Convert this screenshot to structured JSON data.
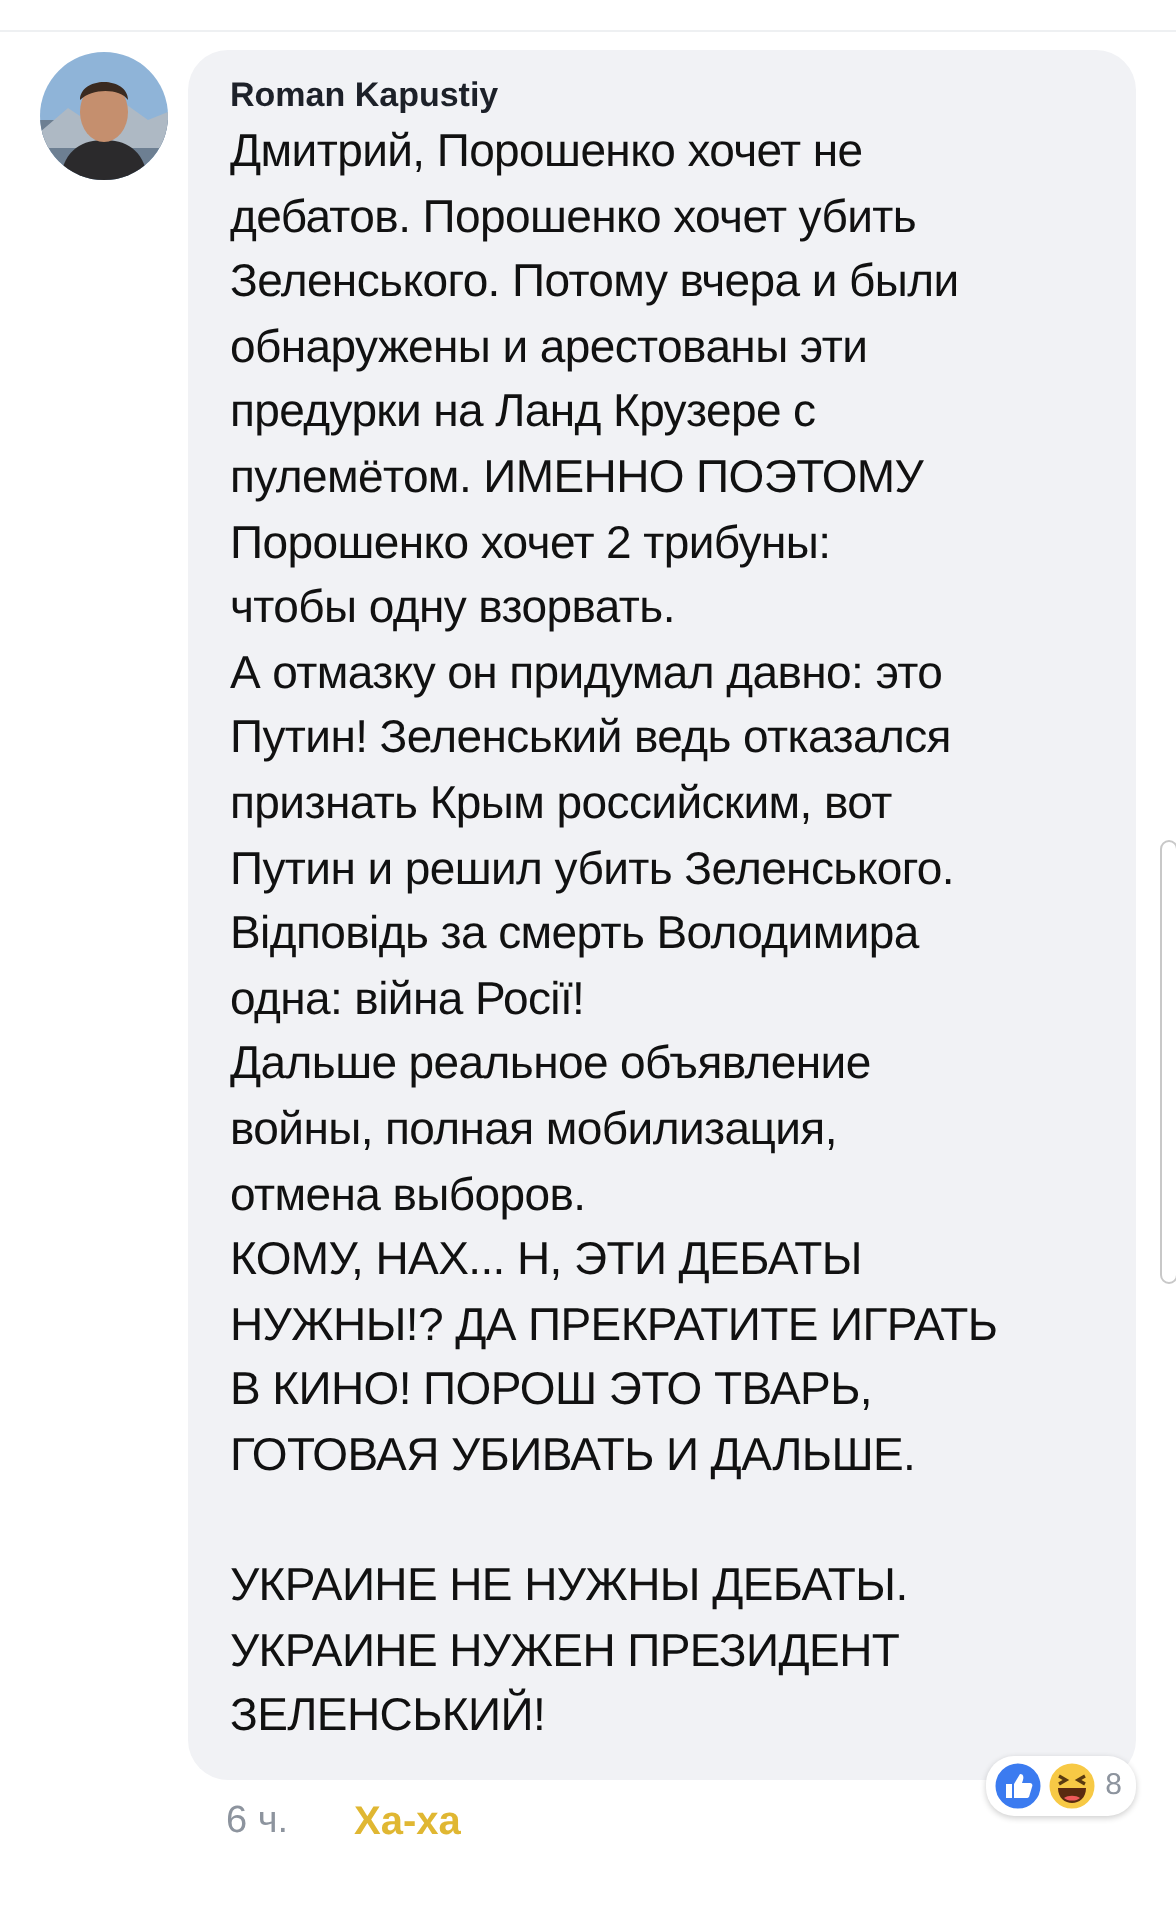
{
  "comment": {
    "author": "Roman Kapustiy",
    "paragraphs": [
      {
        "text": "Дмитрий, Порошенко хочет не\nдебатов. Порошенко хочет убить\nЗеленського. Потому вчера и были\nобнаружены и арестованы эти\nпредурки на Ланд Крузере с\nпулемётом. ИМЕННО ПОЭТОМУ\nПорошенко хочет 2 трибуны:\nчтобы одну взорвать.",
        "gap_before": false
      },
      {
        "text": "А отмазку он придумал давно: это\nПутин! Зеленський ведь отказался\nпризнать Крым российским, вот\nПутин и решил убить Зеленського.\nВідповідь за смерть Володимира\nодна: війна Росії!",
        "gap_before": false
      },
      {
        "text": "Дальше реальное объявление\nвойны, полная мобилизация,\nотмена выборов.",
        "gap_before": false
      },
      {
        "text": "КОМУ, НАХ... Н, ЭТИ ДЕБАТЫ\nНУЖНЫ!? ДА ПРЕКРАТИТЕ ИГРАТЬ\nВ КИНО! ПОРОШ ЭТО ТВАРЬ,\nГОТОВАЯ УБИВАТЬ И ДАЛЬШЕ.",
        "gap_before": false
      },
      {
        "text": "УКРАИНЕ НЕ НУЖНЫ ДЕБАТЫ.\nУКРАИНЕ НУЖЕН ПРЕЗИДЕНТ\nЗЕЛЕНСЬКИЙ!",
        "gap_before": true
      }
    ],
    "time": "6 ч.",
    "reaction_link": {
      "label": "Ха-ха",
      "active": true
    },
    "reaction_count": "8"
  }
}
